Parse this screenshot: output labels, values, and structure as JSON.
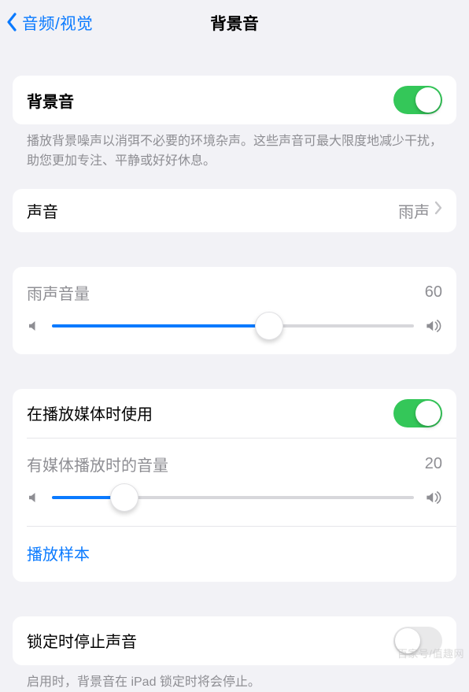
{
  "nav": {
    "back_label": "音频/视觉",
    "title": "背景音"
  },
  "main_toggle": {
    "label": "背景音",
    "on": true,
    "description": "播放背景噪声以消弭不必要的环境杂声。这些声音可最大限度地减少干扰，助您更加专注、平静或好好休息。"
  },
  "sound_row": {
    "label": "声音",
    "value": "雨声"
  },
  "volume1": {
    "label": "雨声音量",
    "value": 60
  },
  "media_toggle": {
    "label": "在播放媒体时使用",
    "on": true
  },
  "volume2": {
    "label": "有媒体播放时的音量",
    "value": 20
  },
  "sample_link": "播放样本",
  "lock_toggle": {
    "label": "锁定时停止声音",
    "on": false,
    "description": "启用时，背景音在 iPad 锁定时将会停止。"
  },
  "watermark": "百家号/值趣网"
}
